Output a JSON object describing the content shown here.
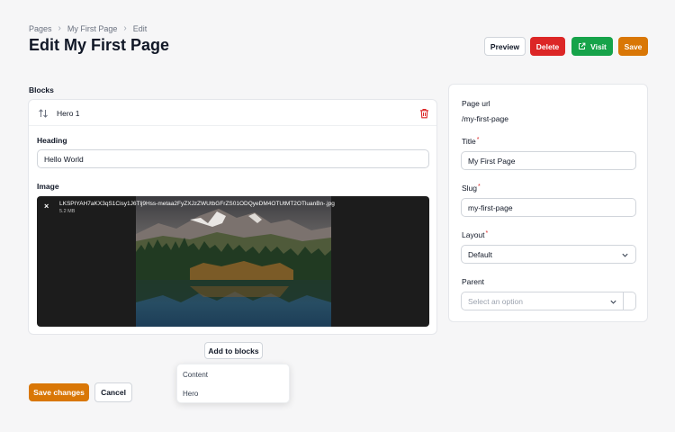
{
  "breadcrumb": [
    "Pages",
    "My First Page",
    "Edit"
  ],
  "page_title": "Edit My First Page",
  "header_buttons": {
    "preview": "Preview",
    "delete": "Delete",
    "visit": "Visit",
    "save": "Save"
  },
  "blocks": {
    "label": "Blocks",
    "block": {
      "name": "Hero 1",
      "heading_label": "Heading",
      "heading_value": "Hello World",
      "image_label": "Image",
      "file_name": "LKSPIYAH7aKX3qS1Cisy1J6Tlj9Hss-metaa2FyZXJzZWUtbGFrZS01ODQyeDM4OTUtMT2OTluanBn-.jpg",
      "file_size": "5.2 MB"
    },
    "add_button": "Add to blocks",
    "dropdown_items": [
      "Content",
      "Hero"
    ]
  },
  "form_buttons": {
    "save_changes": "Save changes",
    "cancel": "Cancel"
  },
  "sidebar": {
    "page_url_label": "Page url",
    "page_url_value": "/my-first-page",
    "title_label": "Title",
    "title_value": "My First Page",
    "slug_label": "Slug",
    "slug_value": "my-first-page",
    "layout_label": "Layout",
    "layout_value": "Default",
    "parent_label": "Parent",
    "parent_placeholder": "Select an option",
    "required_mark": "*"
  },
  "colors": {
    "accent": "#d97706",
    "danger": "#dc2626",
    "success": "#16a34a"
  }
}
